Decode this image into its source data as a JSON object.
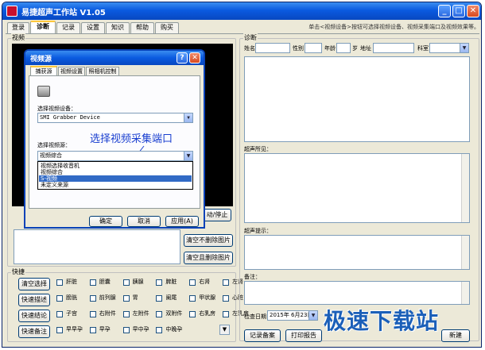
{
  "window": {
    "title": "易捷超声工作站 V1.05"
  },
  "tabs": [
    {
      "label": "登录"
    },
    {
      "label": "诊断"
    },
    {
      "label": "记录"
    },
    {
      "label": "设置"
    },
    {
      "label": "知识"
    },
    {
      "label": "帮助"
    },
    {
      "label": "购买"
    }
  ],
  "hint": "单击<视频设备>按钮可选择视频设备、视频采集端口及视频效果等。",
  "video": {
    "group_label": "视频",
    "start_stop_label": "动/停止",
    "clear_keep_label": "清空不删除图片",
    "clear_delete_label": "清空且删除图片"
  },
  "shortcut": {
    "group_label": "快捷",
    "buttons": [
      "清空选择",
      "快速描述",
      "快速结论",
      "快速备注"
    ],
    "rows": [
      [
        "肝脏",
        "胆囊",
        "胰腺",
        "脾脏",
        "右肾",
        "左肾"
      ],
      [
        "膀胱",
        "前列腺",
        "胃",
        "阑尾",
        "甲状腺",
        "心脏"
      ],
      [
        "子宫",
        "右附件",
        "左附件",
        "双附件",
        "右乳房",
        "左乳房"
      ],
      [
        "早早孕",
        "早孕",
        "早中孕",
        "中晚孕",
        "",
        ""
      ]
    ]
  },
  "diagnosis": {
    "group_label": "诊断",
    "name_label": "姓名",
    "gender_label": "性别",
    "age_label": "年龄",
    "age_unit": "岁",
    "address_label": "地址",
    "dept_label": "科室",
    "findings_label": "超声所见：",
    "tips_label": "超声提示：",
    "notes_label": "备注：",
    "date_label": "检查日期",
    "date_value": "2015年 6月23日",
    "save_record_label": "记录备案",
    "print_label": "打印报告",
    "new_label": "新建"
  },
  "dialog": {
    "title": "视频源",
    "tabs": [
      "捕获源",
      "视频设置",
      "照相机控制"
    ],
    "device_label": "选择视频设备：",
    "device_value": "SMI Grabber Device",
    "port_label": "选择视频源：",
    "port_value": "视频综合",
    "port_options": [
      "视频选择收音机",
      "视频综合",
      "S-视频",
      "未定义来源"
    ],
    "selected_index": 2,
    "annotation": "选择视频采集端口",
    "ok_label": "确定",
    "cancel_label": "取消",
    "apply_label": "应用(A)"
  },
  "watermark": "极速下载站",
  "colors": {
    "title_blue": "#0a5ae0",
    "selection": "#316ac5",
    "close_red": "#d84a20"
  }
}
